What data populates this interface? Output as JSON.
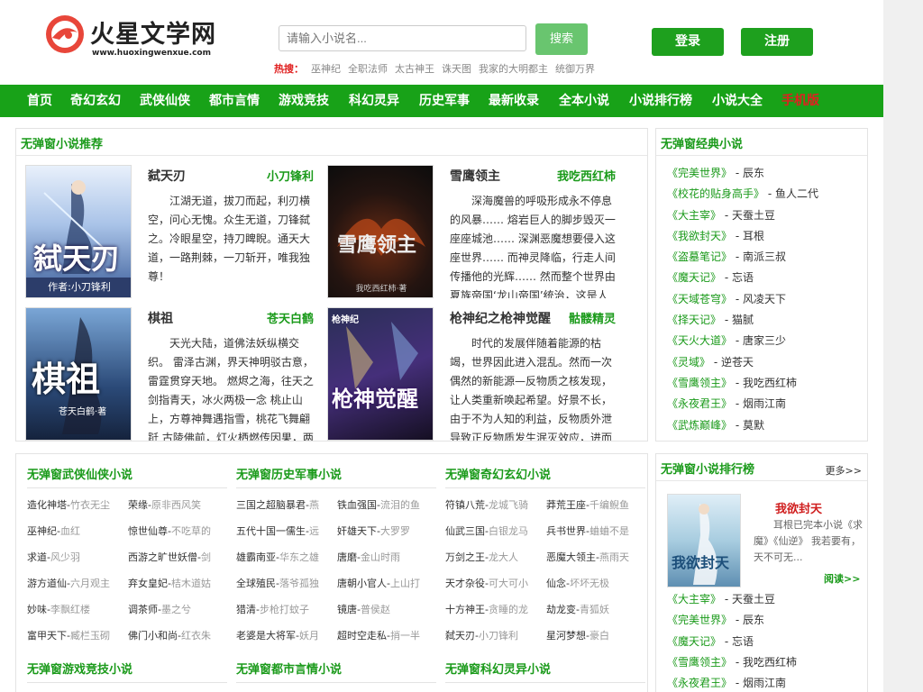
{
  "header": {
    "logo_text": "火星文学网",
    "logo_url": "www.huoxingwenxue.com",
    "search_placeholder": "请输入小说名...",
    "search_button": "搜索",
    "hot_label": "热搜：",
    "hot_items": [
      "巫神纪",
      "全职法师",
      "太古神王",
      "诛天图",
      "我家的大明都主",
      "统御万界"
    ],
    "login": "登录",
    "register": "注册"
  },
  "nav": [
    "首页",
    "奇幻玄幻",
    "武侠仙侠",
    "都市言情",
    "游戏竞技",
    "科幻灵异",
    "历史军事",
    "最新收录",
    "全本小说",
    "小说排行榜",
    "小说大全",
    "手机版"
  ],
  "recommend": {
    "title": "无弹窗小说推荐",
    "books": [
      {
        "title": "弑天刃",
        "author": "小刀锋利",
        "desc": "江湖无道，拔刀而起，利刃横空，问心无愧。众生无道，刀锋弑之。冷眼星空，持刀睥睨。通天大道，一路荆棘，一刀斩开，唯我独尊！",
        "cover_text": "弑天刃",
        "cover_sub": "作者:小刀锋利"
      },
      {
        "title": "雪鹰领主",
        "author": "我吃西红柿",
        "desc": "深海魔兽的呼吸形成永不停息的风暴…… 熔岩巨人的脚步毁灭一座座城池…… 深渊恶魔想要侵入这座世界…… 而神灵降临，行走人间传播他的光辉…… 然而整个世界由夏族帝国‘龙山帝国’统治，这是人类",
        "cover_text": "雪鹰领主",
        "cover_sub": "我吃西红柿·著"
      },
      {
        "title": "棋祖",
        "author": "苍天白鹤",
        "desc": "天光大陆，道佛法妖纵横交织。 雷泽古渊，界天神明驳古意，雷霆贯穿天地。 燃烬之海，往天之剑指青天，冰火两极一念 桃止山上，方尊神舞遇指雪，桃花飞舞翩跹 古陵佛前，灯火栖燃传因果，两",
        "cover_text": "棋祖",
        "cover_sub": "苍天白鹤·著"
      },
      {
        "title": "枪神纪之枪神觉醒",
        "author": "骷髅精灵",
        "desc": "时代的发展伴随着能源的枯竭，世界因此进入混乱。然而一次偶然的新能源—反物质之核发现，让人类重新唤起希望。好景不长，由于不为人知的利益，反物质外泄导致正反物质发生泯灭效应，进而",
        "cover_text": "枪神觉醒",
        "cover_sub": "枪神纪"
      }
    ]
  },
  "classic": {
    "title": "无弹窗经典小说",
    "items": [
      {
        "title": "完美世界",
        "author": "辰东"
      },
      {
        "title": "校花的贴身高手",
        "author": "鱼人二代"
      },
      {
        "title": "大主宰",
        "author": "天蚕土豆"
      },
      {
        "title": "我欲封天",
        "author": "耳根"
      },
      {
        "title": "盗墓笔记",
        "author": "南派三叔"
      },
      {
        "title": "魔天记",
        "author": "忘语"
      },
      {
        "title": "天域苍穹",
        "author": "风凌天下"
      },
      {
        "title": "择天记",
        "author": "猫腻"
      },
      {
        "title": "天火大道",
        "author": "唐家三少"
      },
      {
        "title": "灵域",
        "author": "逆苍天"
      },
      {
        "title": "雪鹰领主",
        "author": "我吃西红柿"
      },
      {
        "title": "永夜君王",
        "author": "烟雨江南"
      },
      {
        "title": "武炼巅峰",
        "author": "莫默"
      }
    ]
  },
  "categories": [
    {
      "title": "无弹窗武侠仙侠小说",
      "items": [
        {
          "t": "造化神塔",
          "a": "竹衣无尘"
        },
        {
          "t": "荣缘",
          "a": "原非西风笑"
        },
        {
          "t": "巫神纪",
          "a": "血红"
        },
        {
          "t": "惊世仙尊",
          "a": "不吃草的"
        },
        {
          "t": "求道",
          "a": "风少羽"
        },
        {
          "t": "西游之旷世妖僧",
          "a": "剑"
        },
        {
          "t": "游方道仙",
          "a": "六月观主"
        },
        {
          "t": "弃女皇妃",
          "a": "桔木道姑"
        },
        {
          "t": "妙味",
          "a": "李飘红楼"
        },
        {
          "t": "调茶师",
          "a": "墨之兮"
        },
        {
          "t": "富甲天下",
          "a": "臧栏玉砌"
        },
        {
          "t": "佛门小和尚",
          "a": "红衣朱"
        }
      ]
    },
    {
      "title": "无弹窗历史军事小说",
      "items": [
        {
          "t": "三国之超脑暴君",
          "a": "燕"
        },
        {
          "t": "铁血强国",
          "a": "流泪的鱼"
        },
        {
          "t": "五代十国一儒生",
          "a": "远"
        },
        {
          "t": "奸雄天下",
          "a": "大罗罗"
        },
        {
          "t": "雄霸南亚",
          "a": "华东之雄"
        },
        {
          "t": "唐磨",
          "a": "金山时雨"
        },
        {
          "t": "全球殖民",
          "a": "落爷孤独"
        },
        {
          "t": "唐朝小官人",
          "a": "上山打"
        },
        {
          "t": "猎清",
          "a": "步枪打蚊子"
        },
        {
          "t": "镜唐",
          "a": "普侯赵"
        },
        {
          "t": "老婆是大将军",
          "a": "妖月"
        },
        {
          "t": "超时空走私",
          "a": "捎一半"
        }
      ]
    },
    {
      "title": "无弹窗奇幻玄幻小说",
      "items": [
        {
          "t": "符镇八荒",
          "a": "龙城飞骑"
        },
        {
          "t": "莽荒王座",
          "a": "千编鲵鱼"
        },
        {
          "t": "仙武三国",
          "a": "白银龙马"
        },
        {
          "t": "兵书世界",
          "a": "蛐蛐不是"
        },
        {
          "t": "万剑之王",
          "a": "龙大人"
        },
        {
          "t": "恶魔大领主",
          "a": "燕雨天"
        },
        {
          "t": "天才杂役",
          "a": "可大可小"
        },
        {
          "t": "仙念",
          "a": "坏坏无极"
        },
        {
          "t": "十方神王",
          "a": "贪睡的龙"
        },
        {
          "t": "劫龙变",
          "a": "青狐妖"
        },
        {
          "t": "弑天刃",
          "a": "小刀锋利"
        },
        {
          "t": "星河梦想",
          "a": "豪白"
        }
      ]
    }
  ],
  "bottom_titles": [
    "无弹窗游戏竞技小说",
    "无弹窗都市言情小说",
    "无弹窗科幻灵异小说"
  ],
  "ranking": {
    "title": "无弹窗小说排行榜",
    "more": "更多>>",
    "top_name": "我欲封天",
    "top_desc": "耳根已完本小说《求魔》《仙逆》 我若要有，天不可无...",
    "read": "阅读>>",
    "cover_text": "我欲封天",
    "items": [
      {
        "title": "大主宰",
        "author": "天蚕土豆"
      },
      {
        "title": "完美世界",
        "author": "辰东"
      },
      {
        "title": "魔天记",
        "author": "忘语"
      },
      {
        "title": "雪鹰领主",
        "author": "我吃西红柿"
      },
      {
        "title": "永夜君王",
        "author": "烟雨江南"
      }
    ]
  },
  "colors": {
    "green": "#18a218",
    "accent_red": "#e02020",
    "button_green": "#69c56f"
  }
}
